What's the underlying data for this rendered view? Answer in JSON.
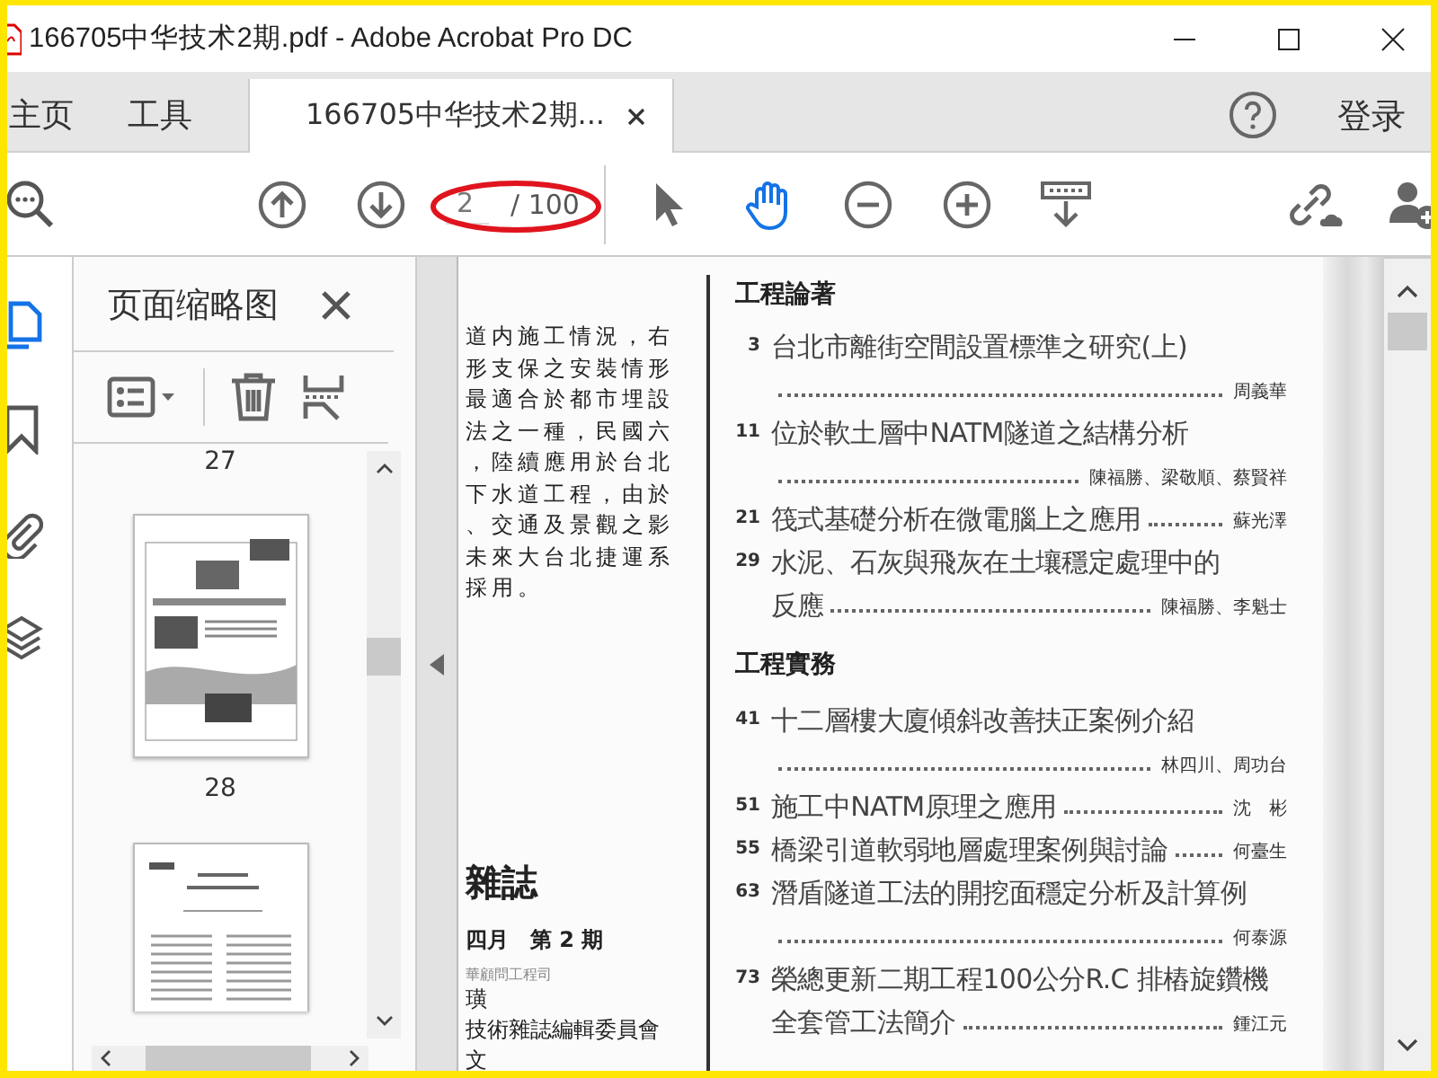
{
  "window": {
    "title": "166705中华技术2期.pdf - Adobe Acrobat Pro DC"
  },
  "tabs": [
    {
      "label": "主页",
      "selected": false,
      "closable": false
    },
    {
      "label": "工具",
      "selected": false,
      "closable": false
    },
    {
      "label": "166705中华技术2期...",
      "selected": true,
      "closable": true
    }
  ],
  "sign_in": "登录",
  "toolbar": {
    "page": {
      "value": "2",
      "total": "/ 100",
      "circled": true
    },
    "tools": [
      {
        "kind": "select",
        "selected": false
      },
      {
        "kind": "hand",
        "selected": true
      },
      {
        "kind": "zoom-out",
        "selected": false
      },
      {
        "kind": "zoom-in",
        "selected": false
      },
      {
        "kind": "scroll-mode",
        "selected": false
      }
    ]
  },
  "rail": [
    {
      "kind": "pages",
      "selected": true
    },
    {
      "kind": "bookmark",
      "selected": false
    },
    {
      "kind": "attachment",
      "selected": false
    },
    {
      "kind": "layers",
      "selected": false
    }
  ],
  "sidebar": {
    "title": "页面缩略图",
    "thumbnails": [
      {
        "label": "27"
      },
      {
        "kind": "photo-page",
        "label": "28"
      },
      {
        "kind": "text-page"
      }
    ]
  },
  "document": {
    "left_lines": [
      "道内施工情況，右",
      "形支保之安裝情形",
      "最適合於都市埋設",
      "法之一種，民國六",
      "，陸續應用於台北",
      "下水道工程，由於",
      "、交通及景觀之影",
      "未來大台北捷運系",
      "採用。"
    ],
    "masthead": "雜誌",
    "issue": "四月　第 2 期",
    "publisher": "華顧問工程司",
    "credits": [
      "璜",
      "技術雜誌編輯委員會",
      "文"
    ],
    "sections": [
      {
        "heading": "工程論著",
        "entries": [
          {
            "page": "3",
            "lines": [
              "台北市離街空間設置標準之研究(上)"
            ],
            "author": "周義華",
            "kind": "below"
          },
          {
            "page": "11",
            "lines": [
              "位於軟土層中NATM隧道之結構分析"
            ],
            "author": "陳福勝、梁敬順、蔡賢祥",
            "kind": "below"
          },
          {
            "page": "21",
            "lines": [
              "筏式基礎分析在微電腦上之應用"
            ],
            "author": "蘇光澤",
            "kind": "inline"
          },
          {
            "page": "29",
            "lines": [
              "水泥、石灰與飛灰在土壤穩定處理中的",
              "反應"
            ],
            "author": "陳福勝、李魁士",
            "kind": "inline"
          }
        ]
      },
      {
        "heading": "工程實務",
        "entries": [
          {
            "page": "41",
            "lines": [
              "十二層樓大廈傾斜改善扶正案例介紹"
            ],
            "author": "林四川、周功台",
            "kind": "below"
          },
          {
            "page": "51",
            "lines": [
              "施工中NATM原理之應用"
            ],
            "author": "沈　彬",
            "kind": "inline"
          },
          {
            "page": "55",
            "lines": [
              "橋梁引道軟弱地層處理案例與討論"
            ],
            "author": "何臺生",
            "kind": "inline"
          },
          {
            "page": "63",
            "lines": [
              "潛盾隧道工法的開挖面穩定分析及計算例"
            ],
            "author": "何泰源",
            "kind": "below"
          },
          {
            "page": "73",
            "lines": [
              "榮總更新二期工程100公分R.C 排樁旋鑽機",
              "全套管工法簡介"
            ],
            "author": "鍾江元",
            "kind": "inline"
          }
        ]
      }
    ]
  }
}
